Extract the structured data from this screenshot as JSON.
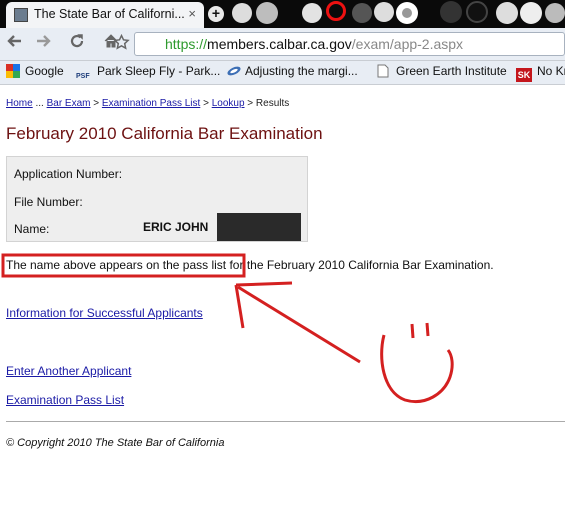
{
  "browser": {
    "tab_title": "The State Bar of Californi...",
    "tab_close": "×",
    "new_tab": "+",
    "url_scheme": "https://",
    "url_host": "members.calbar.ca.gov",
    "url_path": "/exam/app-2.aspx",
    "icons": {
      "back": "left-arrow",
      "forward": "right-arrow",
      "reload": "reload",
      "home": "home",
      "bookmark": "star"
    },
    "bookmarks": [
      {
        "label": "Google",
        "icon": "google-icon"
      },
      {
        "label": "Park Sleep Fly - Park...",
        "icon": "psf-icon"
      },
      {
        "label": "Adjusting the margi...",
        "icon": "orbit-icon"
      },
      {
        "label": "Green Earth Institute",
        "icon": "page-icon"
      },
      {
        "label": "No Kr",
        "icon": "sk-icon",
        "icon_text": "SK"
      }
    ],
    "psf_icon_text": "PSF"
  },
  "page": {
    "breadcrumb": {
      "home": "Home",
      "sep1": " ... ",
      "bar_exam": "Bar Exam",
      "sep2": " > ",
      "pass_list": "Examination Pass List",
      "sep3": " > ",
      "lookup": "Lookup",
      "sep4": " > ",
      "current": "Results"
    },
    "title": "February 2010 California Bar Examination",
    "fields": {
      "application_label": "Application Number:",
      "file_label": "File Number:",
      "name_label": "Name:",
      "name_value": "ERIC JOHN"
    },
    "message_highlight": "The name above appears on the pass list",
    "message_rest": " for the February 2010 California Bar Examination.",
    "link_info": "Information for Successful Applicants",
    "link_another": "Enter Another Applicant",
    "link_pass_list": "Examination Pass List",
    "copyright": "© Copyright 2010 The State Bar of California"
  },
  "colors": {
    "annotation_red": "#d42020",
    "heading": "#6d1111",
    "link": "#1a1aa6",
    "url_scheme": "#2e9a2e"
  }
}
